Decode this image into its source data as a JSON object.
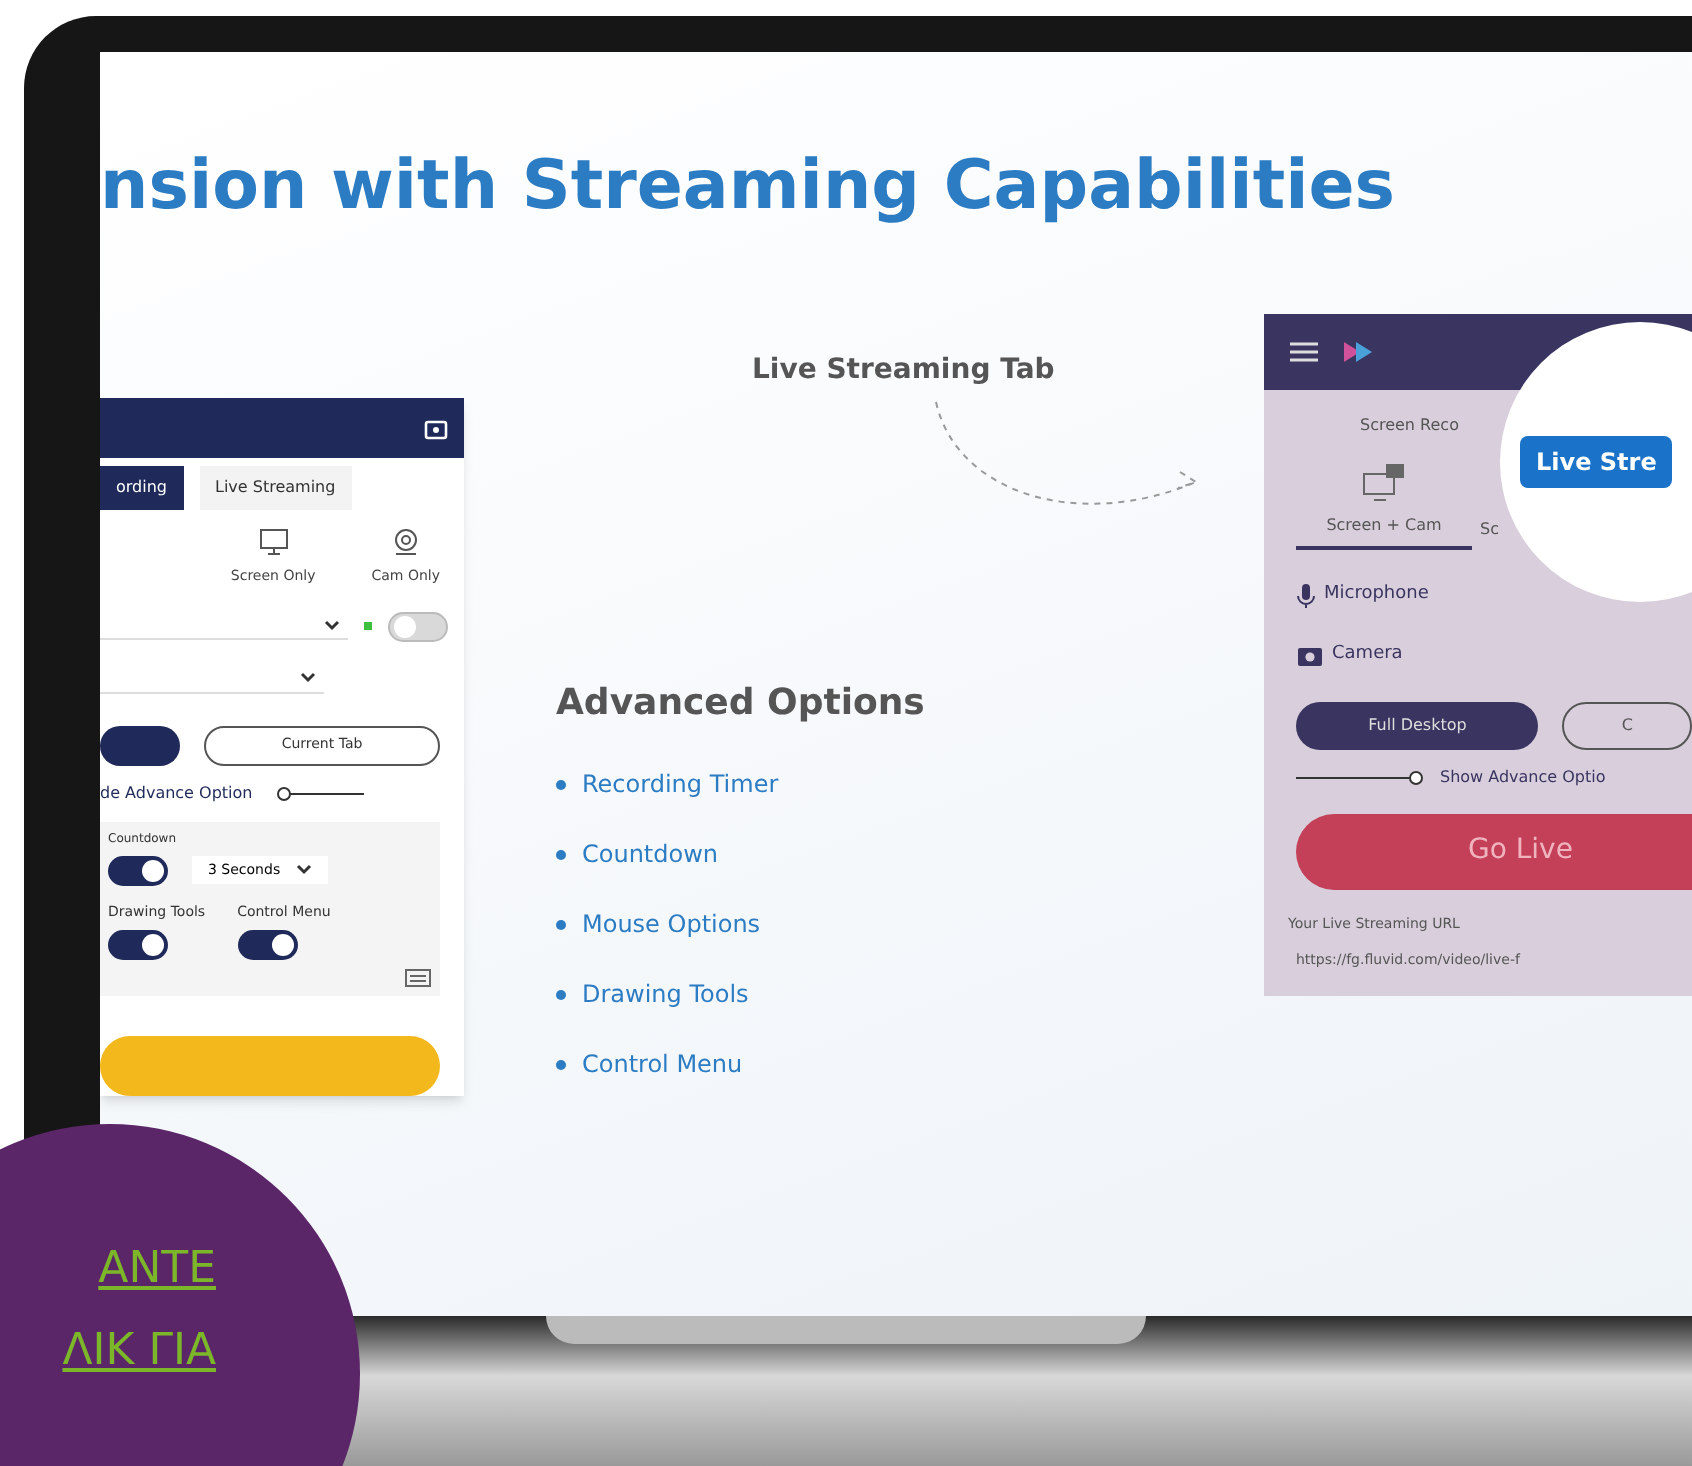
{
  "headline": "nsion with **Streaming** Capabilities",
  "left_panel": {
    "tabs": [
      {
        "label": "ording",
        "selected": true
      },
      {
        "label": "Live Streaming",
        "selected": false
      }
    ],
    "modes": [
      {
        "label": "Screen Only",
        "kind": "screen"
      },
      {
        "label": "Cam Only",
        "kind": "cam"
      }
    ],
    "audio_toggle": {
      "on": false
    },
    "source_buttons": [
      {
        "selected": true
      },
      {
        "label": "Current Tab",
        "selected": false
      }
    ],
    "advance_label": "de Advance Option",
    "countdown": {
      "label": "Countdown",
      "on": true,
      "value": "3 Seconds"
    },
    "toggles": [
      {
        "label": "Drawing Tools",
        "on": true
      },
      {
        "label": "Control Menu",
        "on": true
      }
    ]
  },
  "callout_live": "Live Streaming Tab",
  "advanced": {
    "title": "Advanced Options",
    "items": [
      "Recording Timer",
      "Countdown",
      "Mouse Options",
      "Drawing Tools",
      "Control Menu"
    ]
  },
  "right_panel": {
    "tab": "Screen Reco",
    "highlight": "Live Stre",
    "modes": [
      {
        "label": "Screen + Cam",
        "selected": true
      },
      {
        "label": "Sc",
        "selected": false
      }
    ],
    "devices": [
      {
        "label": "Microphone",
        "kind": "mic"
      },
      {
        "label": "Camera",
        "kind": "camera"
      }
    ],
    "source_buttons": [
      {
        "label": "Full Desktop",
        "selected": true
      },
      {
        "label": "C",
        "selected": false
      }
    ],
    "advance_label": "Show Advance Optio",
    "go_live": "Go Live",
    "url_label": "Your Live Streaming URL",
    "url": "https://fg.fluvid.com/video/live-f"
  },
  "overlay_link": [
    "ΑΝΤΕ",
    "ΛΙΚ ΓΙΑ"
  ]
}
